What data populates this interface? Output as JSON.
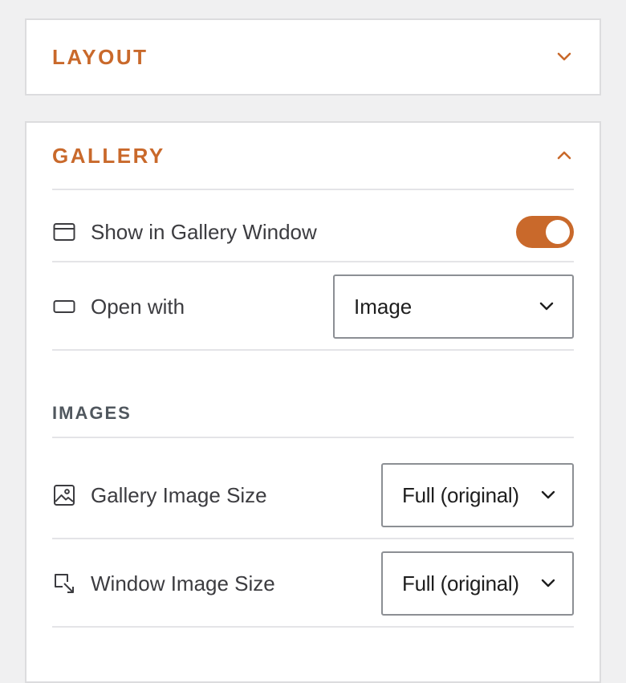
{
  "layout_panel": {
    "title": "LAYOUT",
    "expanded": false
  },
  "gallery_panel": {
    "title": "GALLERY",
    "expanded": true,
    "show_in_gallery_window": {
      "label": "Show in Gallery Window",
      "enabled": true
    },
    "open_with": {
      "label": "Open with",
      "value": "Image"
    },
    "images_section": {
      "title": "IMAGES",
      "gallery_image_size": {
        "label": "Gallery Image Size",
        "value": "Full (original)"
      },
      "window_image_size": {
        "label": "Window Image Size",
        "value": "Full (original)"
      }
    }
  },
  "colors": {
    "accent": "#c9692b",
    "panel_bg": "#ffffff",
    "page_bg": "#f0f0f1",
    "border": "#dcdcde"
  },
  "icons": {
    "layout_toggle": "chevron-down-icon",
    "gallery_toggle": "chevron-up-icon",
    "show_in_gallery_window": "browser-window-icon",
    "open_with": "rectangle-icon",
    "gallery_image_size": "image-icon",
    "window_image_size": "resize-arrow-icon",
    "select_arrow": "chevron-down-icon"
  }
}
